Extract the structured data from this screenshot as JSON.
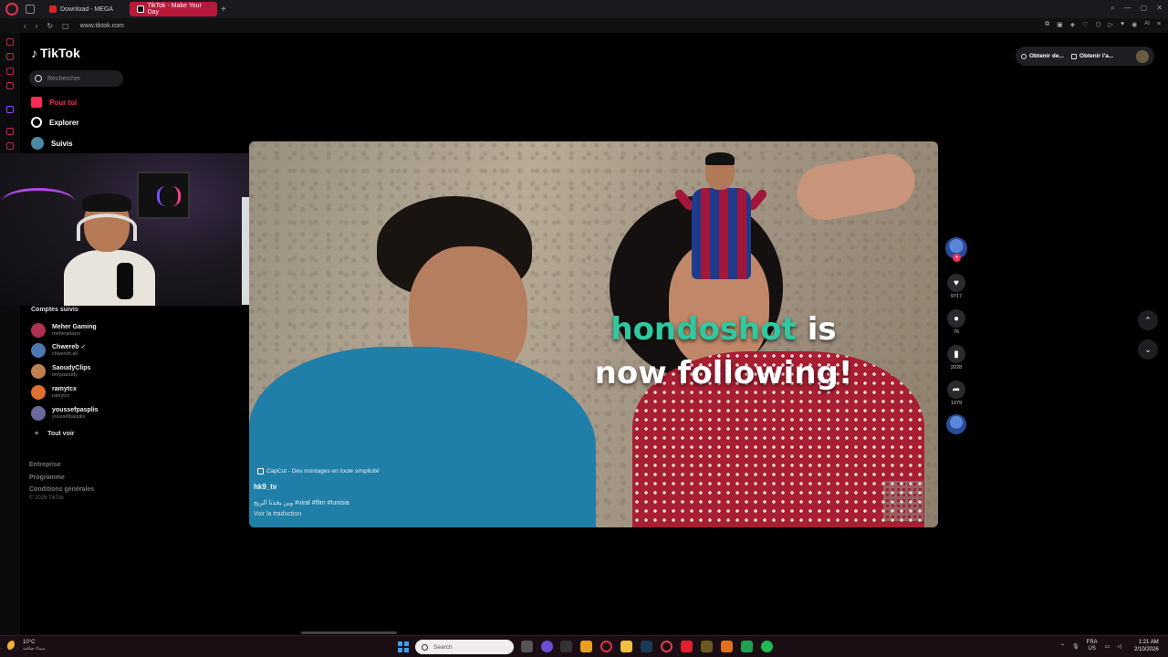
{
  "browser": {
    "tabs": [
      {
        "label": "Download - MEGA",
        "active": false
      },
      {
        "label": "TikTok - Make Your Day",
        "active": true
      }
    ],
    "new_tab": "+",
    "url": "www.tiktok.com",
    "ai_label": "AI"
  },
  "sidebar": {
    "brand": "TikTok",
    "search_placeholder": "Rechercher",
    "nav": [
      {
        "label": "Pour toi",
        "active": true
      },
      {
        "label": "Explorer",
        "active": false
      },
      {
        "label": "Suivis",
        "active": false
      }
    ],
    "followed_title": "Comptes suivis",
    "accounts": [
      {
        "name": "Meher Gaming",
        "handle": "meherjelassi",
        "color": "#b03050"
      },
      {
        "name": "Chwereb",
        "handle": "chwereb.all",
        "color": "#4a7ab0"
      },
      {
        "name": "SaoudyClips",
        "handle": "onlysaoudy",
        "color": "#c08050"
      },
      {
        "name": "ramytcx",
        "handle": "ramytcx",
        "color": "#e07030"
      },
      {
        "name": "youssefpasplis",
        "handle": "youssefpasplis",
        "color": "#6a6a9a"
      }
    ],
    "see_all": "Tout voir",
    "footer_links": [
      "Entreprise",
      "Programme",
      "Conditions générales"
    ],
    "copyright": "© 2026 TikTok"
  },
  "top_actions": {
    "btn1": "Obtenir de...",
    "btn2": "Obtenir l'a..."
  },
  "video": {
    "overlay_user": "hondoshot",
    "overlay_rest": " is now following!",
    "capcut": "CapCut - Des montages en toute simplicité",
    "author": "hk9_tv",
    "caption": "وين يخذنا الريح #viral #film #tunisia",
    "translate": "Voir la traduction"
  },
  "actions": {
    "likes": "9717",
    "comments": "76",
    "saves": "2028",
    "shares": "1979"
  },
  "taskbar": {
    "temp": "10°C",
    "weather_desc": "سماء صافية",
    "search": "Search",
    "lang1": "FRA",
    "lang2": "US",
    "time": "1:21 AM",
    "date": "2/10/2026"
  }
}
